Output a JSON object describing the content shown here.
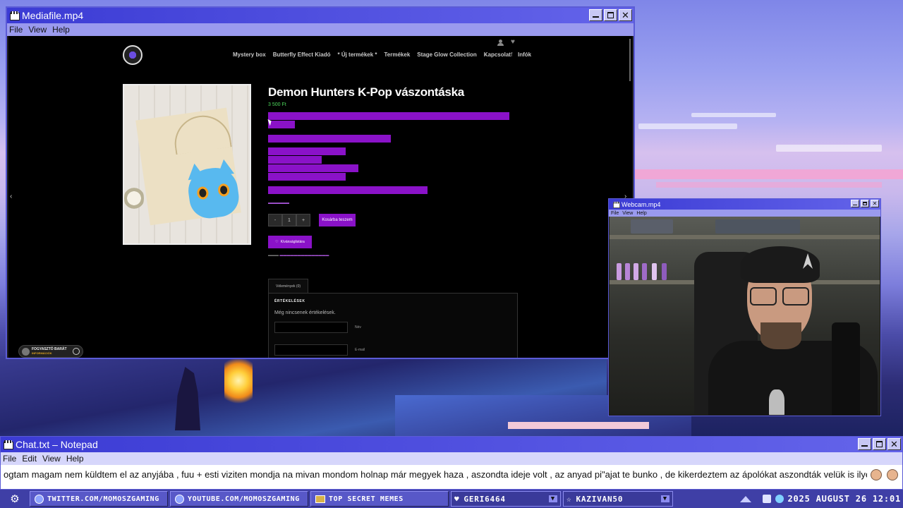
{
  "media_window": {
    "title": "Mediafile.mp4",
    "menu": [
      "File",
      "View",
      "Help"
    ]
  },
  "website": {
    "nav_links": [
      "Mystery box",
      "Butterfly Effect Kiadó",
      "* Új termékek *",
      "Termékek",
      "Stage Glow Collection",
      "Kapcsolat",
      "Infók"
    ],
    "product_title": "Demon Hunters K-Pop vászontáska",
    "price": "3 500 Ft",
    "quantity": "1",
    "qty_minus": "-",
    "qty_plus": "+",
    "add_to_cart": "Kosárba teszem",
    "wishlist": "Kívánságlistára",
    "reviews_tab": "Vélemények (0)",
    "reviews_heading": "ÉRTÉKELÉSEK",
    "no_reviews": "Még nincsenek értékelések.",
    "field_name_label": "Név",
    "field_email_label": "E-mail",
    "access_badge_title": "FOGYASZTÓ BARÁT",
    "access_badge_sub": "INFORMÁCIÓK"
  },
  "webcam_window": {
    "title": "Webcam.mp4",
    "menu": [
      "File",
      "View",
      "Help"
    ]
  },
  "notepad_window": {
    "title": "Chat.txt – Notepad",
    "menu": [
      "File",
      "Edit",
      "View",
      "Help"
    ],
    "text": "ogtam magam nem küldtem el az anyjába , fuu + esti viziten mondja na mivan mondom holnap már megyek haza , aszondta ideje volt , az anyad pi\"ajat te bunko , de kikerdeztem az ápolókat aszondták velük is ilyen hü\"yékkel ne foglalkozzak biztos nem kapott pi\"at"
  },
  "taskbar": {
    "items": [
      {
        "label": "TWITTER.COM/MOMOSZGAMING",
        "icon": "globe-icon"
      },
      {
        "label": "YOUTUBE.COM/MOMOSZGAMING",
        "icon": "globe-icon"
      },
      {
        "label": "TOP SECRET MEMES",
        "icon": "folder-icon"
      }
    ],
    "user_field": "GERI6464",
    "star_field": "KAZIVAN50",
    "datetime": "2025 AUGUST 26 12:01"
  },
  "colors": {
    "accent": "#8a12c8",
    "price_green": "#4dd75c",
    "titlebar": "#3b3bd4"
  }
}
